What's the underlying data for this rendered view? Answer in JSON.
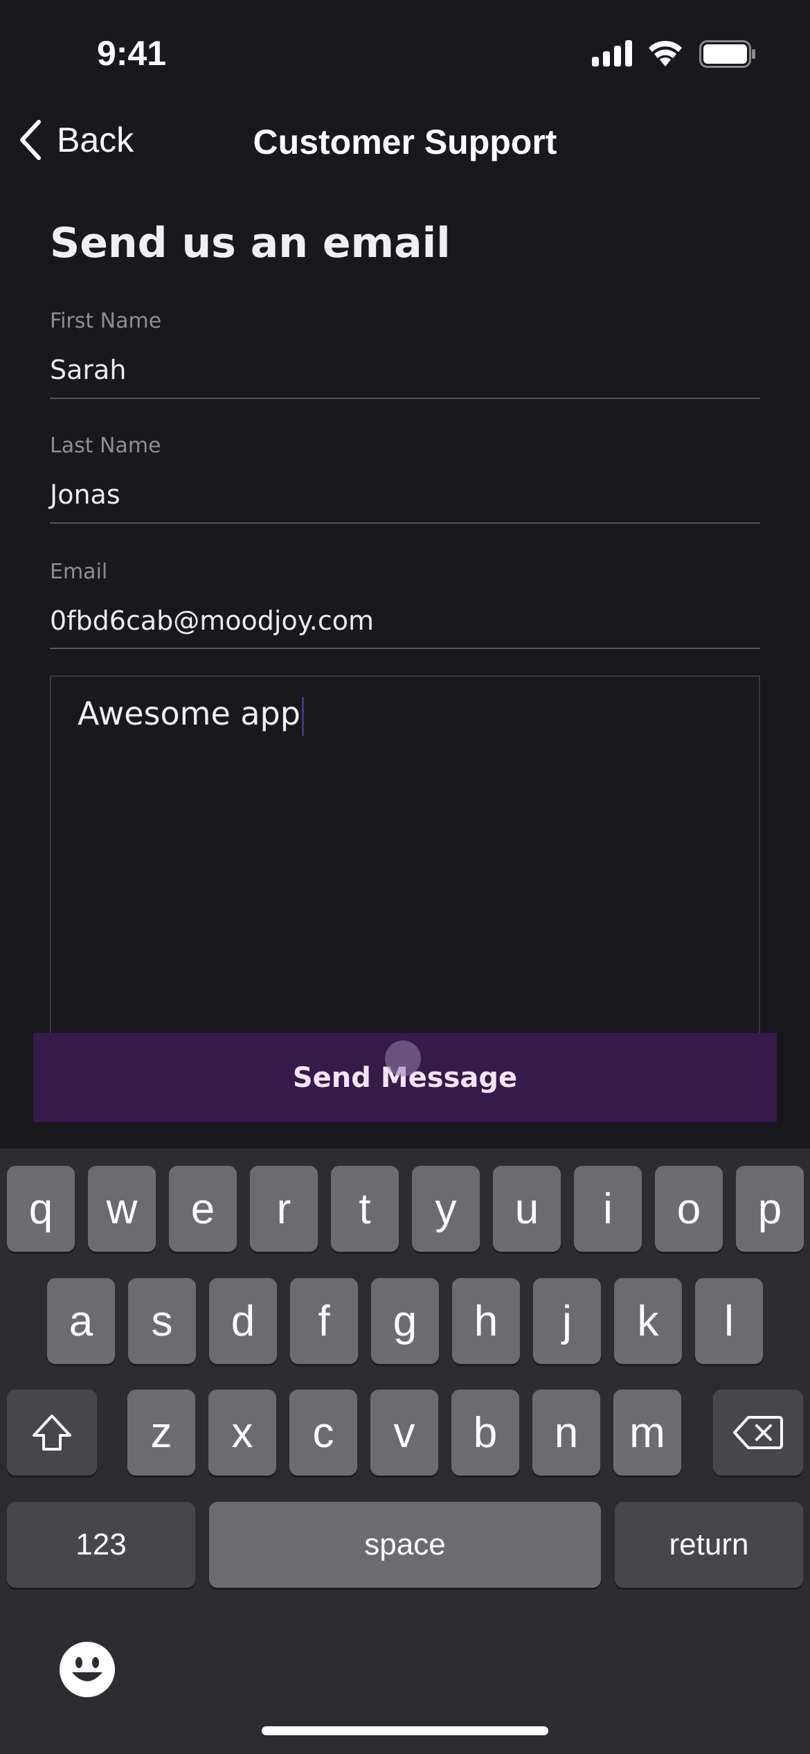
{
  "status_bar": {
    "time": "9:41",
    "icons": [
      "signal-icon",
      "wifi-icon",
      "battery-icon"
    ]
  },
  "nav": {
    "back_label": "Back",
    "title": "Customer Support"
  },
  "form": {
    "heading": "Send us an email",
    "first_name": {
      "label": "First Name",
      "value": "Sarah"
    },
    "last_name": {
      "label": "Last Name",
      "value": "Jonas"
    },
    "email": {
      "label": "Email",
      "value": "0fbd6cab@moodjoy.com"
    },
    "message": {
      "value": "Awesome app"
    },
    "submit_label": "Send Message"
  },
  "colors": {
    "background": "#19181d",
    "button": "#351a4a",
    "keyboard": "#2d2c31",
    "key": "#6c6b70"
  },
  "keyboard": {
    "row1": [
      "q",
      "w",
      "e",
      "r",
      "t",
      "y",
      "u",
      "i",
      "o",
      "p"
    ],
    "row2": [
      "a",
      "s",
      "d",
      "f",
      "g",
      "h",
      "j",
      "k",
      "l"
    ],
    "row3": [
      "z",
      "x",
      "c",
      "v",
      "b",
      "n",
      "m"
    ],
    "numbers_label": "123",
    "space_label": "space",
    "return_label": "return",
    "shift_icon": "shift-icon",
    "delete_icon": "delete-icon",
    "emoji_icon": "emoji-icon"
  }
}
